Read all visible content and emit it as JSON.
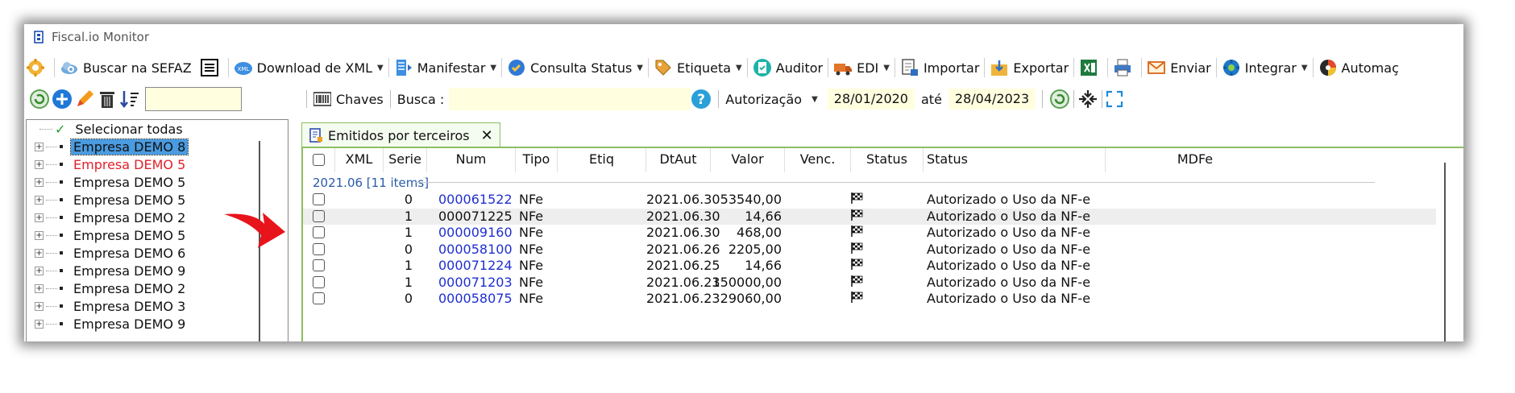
{
  "window_title": "Fiscal.io Monitor",
  "toolbar": {
    "buscar": "Buscar na SEFAZ",
    "download": "Download de XML",
    "manifestar": "Manifestar",
    "consulta": "Consulta Status",
    "etiqueta": "Etiqueta",
    "auditor": "Auditor",
    "edi": "EDI",
    "importar": "Importar",
    "exportar": "Exportar",
    "enviar": "Enviar",
    "integrar": "Integrar",
    "automacao": "Automaç"
  },
  "filter": {
    "chaves": "Chaves",
    "busca_label": "Busca :",
    "date_type": "Autorização",
    "date_from": "28/01/2020",
    "ate": "até",
    "date_to": "28/04/2023"
  },
  "tree": {
    "select_all": "Selecionar todas",
    "items": [
      {
        "label": "Empresa DEMO 8",
        "selected": true,
        "red": false
      },
      {
        "label": "Empresa DEMO 5",
        "selected": false,
        "red": true
      },
      {
        "label": "Empresa DEMO 5",
        "selected": false,
        "red": false
      },
      {
        "label": "Empresa DEMO 5",
        "selected": false,
        "red": false
      },
      {
        "label": "Empresa DEMO 2",
        "selected": false,
        "red": false
      },
      {
        "label": "Empresa DEMO 5",
        "selected": false,
        "red": false
      },
      {
        "label": "Empresa DEMO 6",
        "selected": false,
        "red": false
      },
      {
        "label": "Empresa DEMO 9",
        "selected": false,
        "red": false
      },
      {
        "label": "Empresa DEMO 2",
        "selected": false,
        "red": false
      },
      {
        "label": "Empresa DEMO 3",
        "selected": false,
        "red": false
      },
      {
        "label": "Empresa DEMO 9",
        "selected": false,
        "red": false
      }
    ]
  },
  "tab": {
    "label": "Emitidos por terceiros",
    "close": "✕"
  },
  "grid": {
    "columns": [
      "XML",
      "Serie",
      "Num",
      "Tipo",
      "Etiq",
      "DtAut",
      "Valor",
      "Venc.",
      "Status",
      "Status",
      "MDFe"
    ],
    "group_label": "2021.06 [11 items]",
    "rows": [
      {
        "serie": "0",
        "num": "000061522",
        "link": true,
        "tipo": "NFe",
        "dtaut": "2021.06.30",
        "valor": "53540,00",
        "status": "Autorizado o Uso da NF-e"
      },
      {
        "serie": "1",
        "num": "000071225",
        "link": false,
        "tipo": "NFe",
        "dtaut": "2021.06.30",
        "valor": "14,66",
        "status": "Autorizado o Uso da NF-e"
      },
      {
        "serie": "1",
        "num": "000009160",
        "link": true,
        "tipo": "NFe",
        "dtaut": "2021.06.30",
        "valor": "468,00",
        "status": "Autorizado o Uso da NF-e"
      },
      {
        "serie": "0",
        "num": "000058100",
        "link": true,
        "tipo": "NFe",
        "dtaut": "2021.06.26",
        "valor": "2205,00",
        "status": "Autorizado o Uso da NF-e"
      },
      {
        "serie": "1",
        "num": "000071224",
        "link": true,
        "tipo": "NFe",
        "dtaut": "2021.06.25",
        "valor": "14,66",
        "status": "Autorizado o Uso da NF-e"
      },
      {
        "serie": "1",
        "num": "000071203",
        "link": true,
        "tipo": "NFe",
        "dtaut": "2021.06.23",
        "valor": "150000,00",
        "status": "Autorizado o Uso da NF-e"
      },
      {
        "serie": "0",
        "num": "000058075",
        "link": true,
        "tipo": "NFe",
        "dtaut": "2021.06.23",
        "valor": "29060,00",
        "status": "Autorizado o Uso da NF-e"
      }
    ],
    "highlighted_row": 1
  },
  "colors": {
    "tab_border": "#8bbf60",
    "link": "#1f2fd0",
    "selected": "#4a9be0",
    "arrow": "#e8141c"
  }
}
